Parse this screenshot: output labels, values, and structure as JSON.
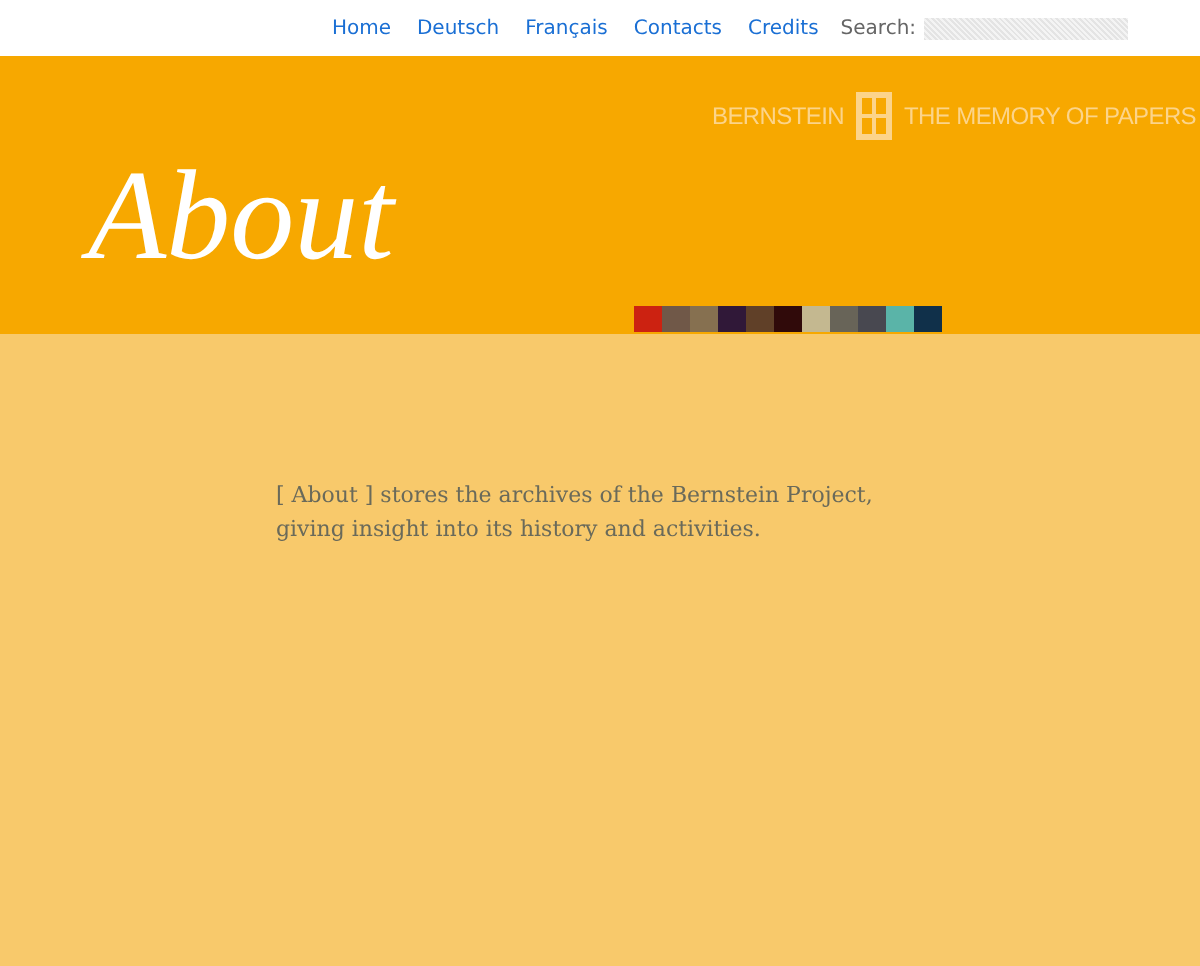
{
  "nav": {
    "links": [
      "Home",
      "Deutsch",
      "Français",
      "Contacts",
      "Credits"
    ],
    "search_label": "Search:"
  },
  "logo": {
    "left": "BERNSTEIN",
    "right": "THE MEMORY OF PAPERS"
  },
  "title": "About",
  "swatches": [
    {
      "color": "#cc2211"
    },
    {
      "color": "#705848"
    },
    {
      "color": "#867050"
    },
    {
      "color": "#301838"
    },
    {
      "color": "#604028"
    },
    {
      "color": "#300a0a"
    },
    {
      "color": "#c4b890"
    },
    {
      "color": "#686458"
    },
    {
      "color": "#484850"
    },
    {
      "color": "#5ab4a8"
    },
    {
      "color": "#10304a"
    }
  ],
  "intro": "[ About ] stores the archives of the Bernstein Project, giving insight into its history and activities."
}
